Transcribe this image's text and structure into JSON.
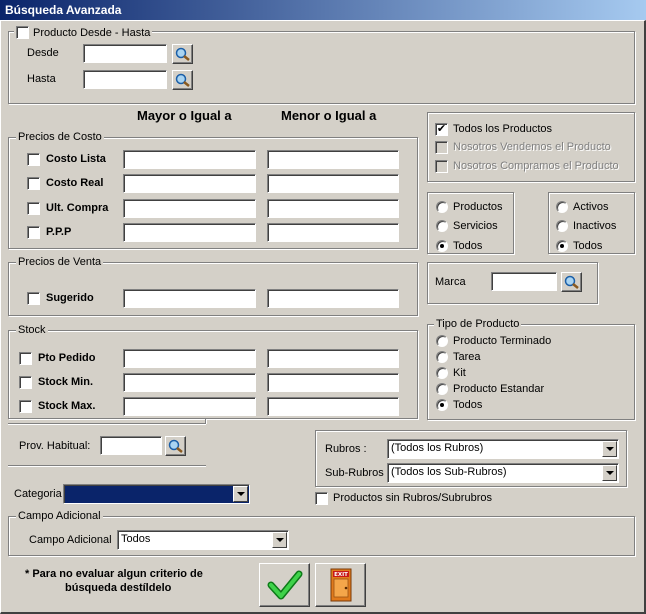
{
  "window": {
    "title": "Búsqueda Avanzada"
  },
  "producto_rango": {
    "checkbox_label": "Producto Desde - Hasta",
    "desde_label": "Desde",
    "hasta_label": "Hasta",
    "desde_value": "",
    "hasta_value": ""
  },
  "column_headers": {
    "mayor": "Mayor o Igual a",
    "menor": "Menor o Igual a"
  },
  "precios_costo": {
    "title": "Precios de Costo",
    "items": [
      "Costo Lista",
      "Costo Real",
      "Ult. Compra",
      "P.P.P"
    ]
  },
  "precios_venta": {
    "title": "Precios de Venta",
    "items": [
      "Sugerido"
    ]
  },
  "stock": {
    "title": "Stock",
    "items": [
      "Pto Pedido",
      "Stock Min.",
      "Stock Max."
    ]
  },
  "todos_productos": {
    "items": [
      {
        "label": "Todos los Productos",
        "checked": true,
        "enabled": true
      },
      {
        "label": "Nosotros Vendemos el Producto",
        "checked": false,
        "enabled": false
      },
      {
        "label": "Nosotros Compramos el Producto",
        "checked": false,
        "enabled": false
      }
    ]
  },
  "tipo_item": {
    "options": [
      "Productos",
      "Servicios",
      "Todos"
    ],
    "selected": "Todos"
  },
  "estado": {
    "options": [
      "Activos",
      "Inactivos",
      "Todos"
    ],
    "selected": "Todos"
  },
  "marca": {
    "label": "Marca",
    "value": ""
  },
  "tipo_producto": {
    "title": "Tipo de Producto",
    "options": [
      "Producto Terminado",
      "Tarea",
      "Kit",
      "Producto Estandar",
      "Todos"
    ],
    "selected": "Todos"
  },
  "prov_habitual": {
    "label": "Prov. Habitual:",
    "value": ""
  },
  "rubros": {
    "rubros_label": "Rubros :",
    "rubros_value": "(Todos los Rubros)",
    "subrubros_label": "Sub-Rubros :",
    "subrubros_value": "(Todos los Sub-Rubros)"
  },
  "sin_rubros": {
    "label": "Productos sin Rubros/Subrubros",
    "checked": false
  },
  "categoria": {
    "label": "Categoria",
    "value": ""
  },
  "campo_adicional": {
    "title": "Campo Adicional",
    "label": "Campo Adicional",
    "value": "Todos"
  },
  "note": {
    "line1": "* Para no evaluar algun criterio de",
    "line2": "búsqueda destíldelo"
  },
  "exit_icon_text": "EXIT",
  "colors": {
    "titlebar": "#0a246a",
    "face": "#d4d0c8",
    "check_green": "#1fae2a",
    "exit_orange": "#e07a1c"
  }
}
